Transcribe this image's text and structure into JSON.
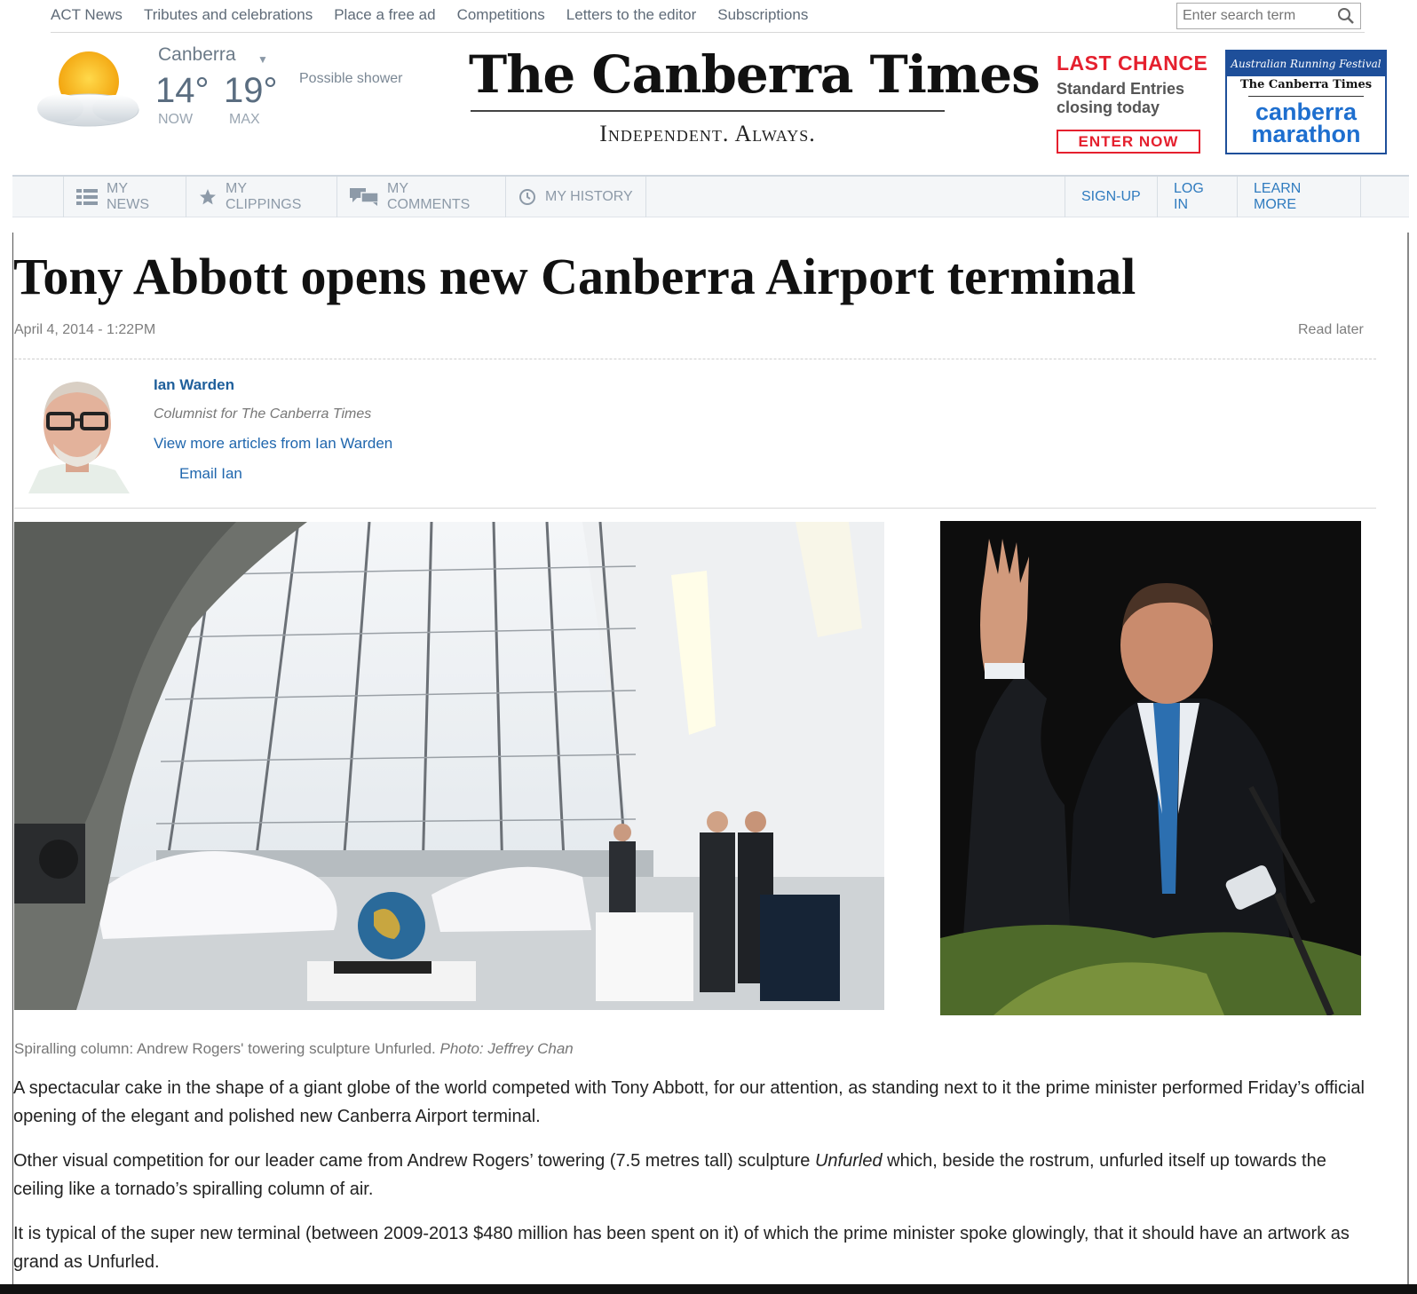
{
  "topnav": {
    "links": [
      "ACT News",
      "Tributes and celebrations",
      "Place a free ad",
      "Competitions",
      "Letters to the editor",
      "Subscriptions"
    ],
    "search_placeholder": "Enter search term"
  },
  "weather": {
    "city": "Canberra",
    "temp_now": "14°",
    "temp_max": "19°",
    "label_now": "NOW",
    "label_max": "MAX",
    "forecast": "Possible shower",
    "icon": "partly-cloudy-icon"
  },
  "masthead": {
    "title": "The Canberra Times",
    "tagline": "Independent. Always."
  },
  "ad": {
    "headline": "LAST CHANCE",
    "text": "Standard Entries closing today",
    "button": "ENTER NOW",
    "badge_top": "Australian Running Festival",
    "badge_paper": "The Canberra Times",
    "badge_name_1": "canberra",
    "badge_name_2": "marathon",
    "accent": "#e5202e",
    "brand": "#1e4f9a"
  },
  "memberbar": {
    "items": [
      {
        "label": "MY NEWS",
        "icon": "list-icon"
      },
      {
        "label": "MY CLIPPINGS",
        "icon": "star-icon"
      },
      {
        "label": "MY COMMENTS",
        "icon": "comments-icon"
      },
      {
        "label": "MY HISTORY",
        "icon": "clock-icon"
      }
    ],
    "actions": [
      "SIGN-UP",
      "LOG IN",
      "LEARN MORE"
    ]
  },
  "article": {
    "headline": "Tony Abbott opens new Canberra Airport terminal",
    "dateline": "April 4, 2014 - 1:22PM",
    "read_later": "Read later",
    "author": {
      "name": "Ian Warden",
      "role": "Columnist for The Canberra Times",
      "more_link": "View more articles from Ian Warden",
      "email_link": "Email Ian"
    },
    "caption": "Spiralling column: Andrew Rogers' towering sculpture Unfurled.",
    "caption_credit": "Photo: Jeffrey Chan",
    "p1": "A spectacular cake in the shape of a giant globe of the world competed with Tony Abbott, for our attention, as standing next to it the prime minister performed Friday’s official opening of the elegant and polished new Canberra Airport terminal.",
    "p2_before": "Other visual competition for our leader came from Andrew Rogers’ towering (7.5 metres tall) sculpture ",
    "p2_em": "Unfurled",
    "p2_after": " which, beside the rostrum, unfurled itself up towards the ceiling like a tornado’s spiralling column of air.",
    "p3": "It is typical of the super new terminal (between 2009-2013  $480 million has been spent on it) of which the prime minister spoke glowingly, that it should have an artwork as grand as Unfurled."
  }
}
